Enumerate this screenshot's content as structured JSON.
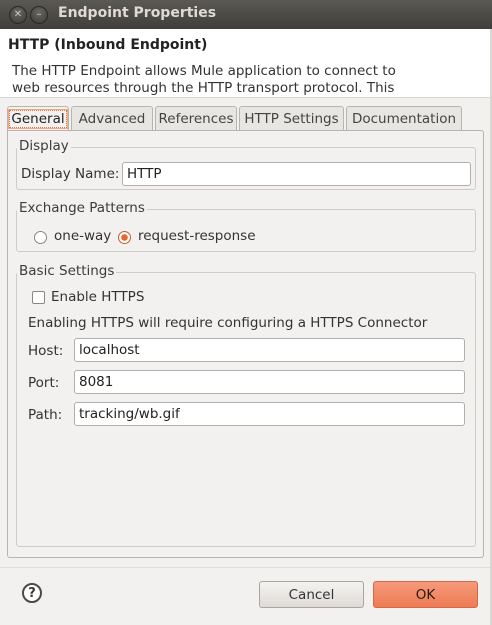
{
  "window": {
    "title": "Endpoint Properties",
    "close_glyph": "✕",
    "minimize_glyph": "–"
  },
  "header": {
    "title": "HTTP (Inbound Endpoint)",
    "description": "The HTTP Endpoint allows Mule application to connect to web resources through the HTTP transport protocol. This"
  },
  "tabs": [
    {
      "label": "General",
      "active": true
    },
    {
      "label": "Advanced"
    },
    {
      "label": "References"
    },
    {
      "label": "HTTP Settings"
    },
    {
      "label": "Documentation"
    }
  ],
  "display": {
    "group_label": "Display",
    "name_label": "Display Name:",
    "name_value": "HTTP"
  },
  "exchange": {
    "group_label": "Exchange Patterns",
    "one_way": "one-way",
    "request_response": "request-response",
    "selected": "request-response"
  },
  "basic": {
    "group_label": "Basic Settings",
    "enable_https_label": "Enable HTTPS",
    "enable_https_checked": false,
    "https_note": "Enabling HTTPS will require configuring a HTTPS Connector",
    "host_label": "Host:",
    "host_value": "localhost",
    "port_label": "Port:",
    "port_value": "8081",
    "path_label": "Path:",
    "path_value": "tracking/wb.gif"
  },
  "footer": {
    "help_glyph": "?",
    "cancel_label": "Cancel",
    "ok_label": "OK"
  },
  "colors": {
    "accent": "#ee7b55",
    "titlebar": "#3f3e3a",
    "background": "#f2f1f0"
  }
}
